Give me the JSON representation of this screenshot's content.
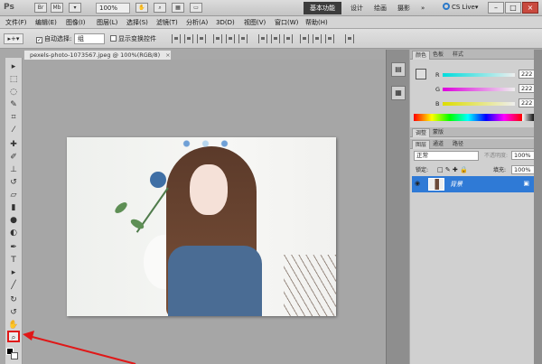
{
  "appbar": {
    "logo": "Ps",
    "icons": [
      "Br",
      "Mb"
    ],
    "zoom": "100%",
    "workspaces": [
      "基本功能",
      "设计",
      "绘画",
      "摄影",
      "»"
    ],
    "cslive": "CS Live▾"
  },
  "menu": [
    "文件(F)",
    "编辑(E)",
    "图像(I)",
    "图层(L)",
    "选择(S)",
    "滤镜(T)",
    "分析(A)",
    "3D(D)",
    "视图(V)",
    "窗口(W)",
    "帮助(H)"
  ],
  "options": {
    "auto_select_label": "自动选择:",
    "group_value": "组",
    "transform_label": "显示变换控件"
  },
  "document": {
    "tab_title": "pexels-photo-1073567.jpeg @ 100%(RGB/8)",
    "close": "×"
  },
  "color_panel": {
    "tabs": [
      "颜色",
      "色板",
      "样式"
    ],
    "channels": [
      {
        "label": "R",
        "value": "222"
      },
      {
        "label": "G",
        "value": "222"
      },
      {
        "label": "B",
        "value": "222"
      }
    ]
  },
  "adjust_panel": {
    "tabs": [
      "调整",
      "蒙版"
    ]
  },
  "layers_panel": {
    "tabs": [
      "图层",
      "通道",
      "路径"
    ],
    "blend_mode": "正常",
    "opacity_label": "不透明度:",
    "opacity": "100%",
    "lock_label": "锁定:",
    "fill_label": "填充:",
    "fill": "100%",
    "layer_name": "背景"
  },
  "colors": {
    "accent": "#2f7ad6",
    "highlight": "#e01818"
  }
}
